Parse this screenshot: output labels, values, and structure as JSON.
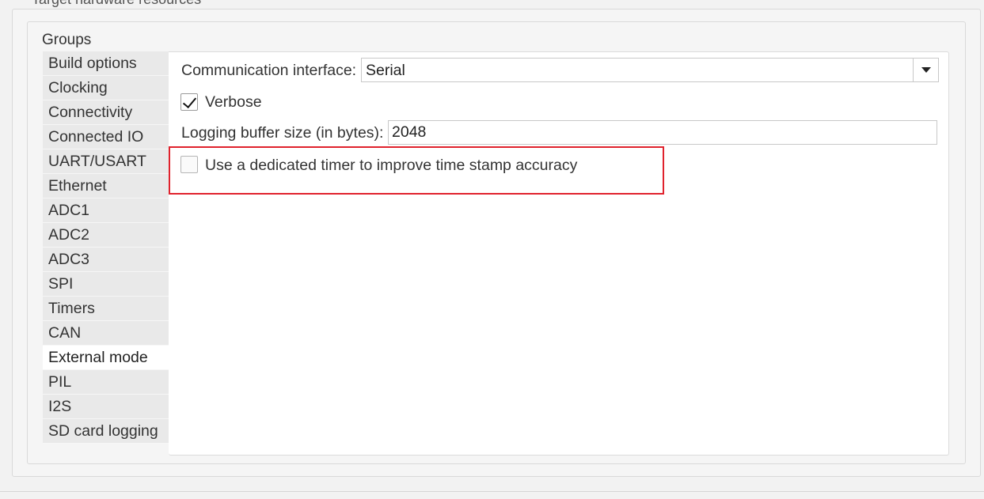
{
  "section": {
    "title": "Target hardware resources"
  },
  "groups": {
    "label": "Groups",
    "items": [
      {
        "label": "Build options"
      },
      {
        "label": "Clocking"
      },
      {
        "label": "Connectivity"
      },
      {
        "label": "Connected IO"
      },
      {
        "label": "UART/USART"
      },
      {
        "label": "Ethernet"
      },
      {
        "label": "ADC1"
      },
      {
        "label": "ADC2"
      },
      {
        "label": "ADC3"
      },
      {
        "label": "SPI"
      },
      {
        "label": "Timers"
      },
      {
        "label": "CAN"
      },
      {
        "label": "External mode"
      },
      {
        "label": "PIL"
      },
      {
        "label": "I2S"
      },
      {
        "label": "SD card logging"
      }
    ],
    "selected": "External mode"
  },
  "external_mode": {
    "communication_interface": {
      "label": "Communication interface:",
      "value": "Serial"
    },
    "verbose": {
      "label": "Verbose",
      "checked": true
    },
    "logging_buffer": {
      "label": "Logging buffer size (in bytes):",
      "value": "2048"
    },
    "dedicated_timer": {
      "label": "Use a dedicated timer to improve time stamp accuracy",
      "checked": false
    }
  },
  "colors": {
    "highlight": "#e0222d",
    "panel_bg": "#ffffff",
    "list_bg": "#e9e9e9"
  }
}
